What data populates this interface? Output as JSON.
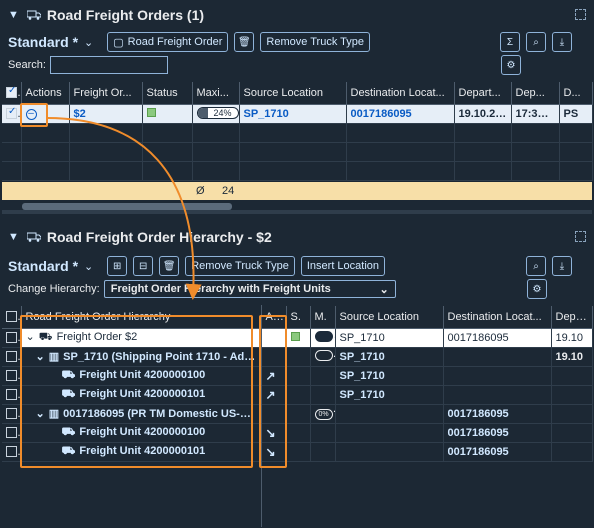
{
  "top": {
    "title": "Road Freight Orders (1)",
    "variant": "Standard *",
    "btn_freight_order": "Road Freight Order",
    "btn_remove_truck": "Remove Truck Type",
    "search_label": "Search:",
    "columns": [
      "Actions",
      "Freight Or...",
      "Status",
      "Maxi...",
      "Source Location",
      "Destination Locat...",
      "Depart...",
      "Dep...",
      "D..."
    ],
    "row": {
      "freight_order": "$2",
      "progress": "24%",
      "progress_value": 24,
      "source": "SP_1710",
      "destination": "0017186095",
      "departure_date": "19.10.20...",
      "departure_time": "17:30:...",
      "d": "PS"
    },
    "totals": {
      "symbol": "Ø",
      "value": "24"
    }
  },
  "hierarchy": {
    "title": "Road Freight Order Hierarchy - $2",
    "variant": "Standard *",
    "btn_remove_truck": "Remove Truck Type",
    "btn_insert_location": "Insert Location",
    "change_label": "Change Hierarchy:",
    "change_value": "Freight Order Hierarchy with Freight Units",
    "columns": [
      "Road Freight Order Hierarchy",
      "A...",
      "S.",
      "M.",
      "Source Location",
      "Destination Locat...",
      "Depa..."
    ],
    "rows": [
      {
        "name": "Freight Order $2",
        "source": "SP_1710",
        "destination": "0017186095",
        "depa": "19.10",
        "status": true,
        "toggle": true
      },
      {
        "name": "SP_1710 (Shipping Point 1710 - Addre...",
        "source": "SP_1710",
        "destination": "",
        "depa": "19.10",
        "status": false,
        "toggle": true
      },
      {
        "name": "Freight Unit 4200000100",
        "source": "SP_1710",
        "destination": "",
        "depa": "",
        "action": "↗"
      },
      {
        "name": "Freight Unit 4200000101",
        "source": "SP_1710",
        "destination": "",
        "depa": "",
        "action": "↗"
      },
      {
        "name": "0017186095 (PR TM Domestic US-CA ...",
        "source": "",
        "destination": "0017186095",
        "depa": "",
        "pct": "0%"
      },
      {
        "name": "Freight Unit 4200000100",
        "source": "",
        "destination": "0017186095",
        "depa": "",
        "action": "↘"
      },
      {
        "name": "Freight Unit 4200000101",
        "source": "",
        "destination": "0017186095",
        "depa": "",
        "action": "↘"
      }
    ]
  },
  "colors": {
    "background": "#1c2834",
    "link": "#d1e8ff",
    "highlight": "#f08c2b",
    "totals": "#f7dfa8",
    "selected_row": "#e6eef7"
  }
}
